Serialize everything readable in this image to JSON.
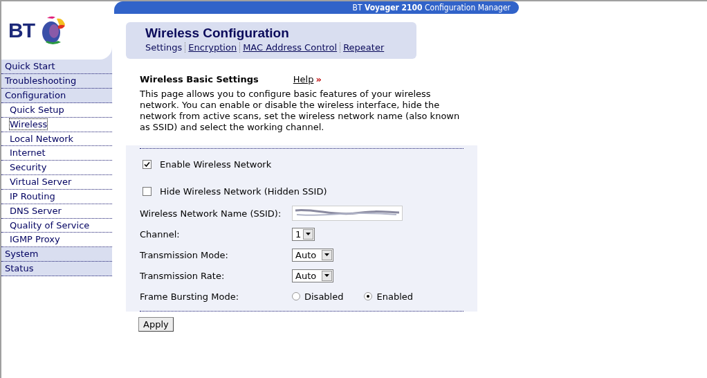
{
  "header": {
    "title": "BT **Voyager 2100** Configuration Manager"
  },
  "logo": {
    "text": "BT"
  },
  "sidebar": {
    "items": [
      {
        "label": "Quick Start",
        "selected": false
      },
      {
        "label": "Troubleshooting",
        "selected": false
      },
      {
        "label": "Configuration",
        "selected": false,
        "children": [
          {
            "label": "Quick Setup",
            "selected": false
          },
          {
            "label": "Wireless",
            "selected": true
          },
          {
            "label": "Local Network",
            "selected": false
          },
          {
            "label": "Internet",
            "selected": false
          },
          {
            "label": "Security",
            "selected": false
          },
          {
            "label": "Virtual Server",
            "selected": false
          },
          {
            "label": "IP Routing",
            "selected": false
          },
          {
            "label": "DNS Server",
            "selected": false
          },
          {
            "label": "Quality of Service",
            "selected": false
          },
          {
            "label": "IGMP Proxy",
            "selected": false
          }
        ]
      },
      {
        "label": "System",
        "selected": false
      },
      {
        "label": "Status",
        "selected": false
      }
    ]
  },
  "page": {
    "title": "Wireless Configuration",
    "tabs": [
      {
        "label": "Settings",
        "selected": true
      },
      {
        "label": "Encryption",
        "selected": false
      },
      {
        "label": "MAC Address Control",
        "selected": false
      },
      {
        "label": "Repeater",
        "selected": false
      }
    ]
  },
  "section": {
    "title": "Wireless Basic Settings",
    "help": "Help",
    "help_icon": "»",
    "description": "This page allows you to configure basic features of your wireless network. You can enable or disable the wireless interface, hide the network from active scans, set the wireless network name (also known as SSID) and select the working channel."
  },
  "form": [
    {
      "kind": "checkbox",
      "label": "Enable Wireless Network",
      "checked": true
    },
    {
      "kind": "checkbox",
      "label": "Hide Wireless Network (Hidden SSID)",
      "checked": false
    },
    {
      "kind": "text",
      "label": "Wireless Network Name (SSID):",
      "redacted": true
    },
    {
      "kind": "select",
      "label": "Channel:",
      "value": "1"
    },
    {
      "kind": "select",
      "label": "Transmission Mode:",
      "value": "Auto"
    },
    {
      "kind": "select",
      "label": "Transmission Rate:",
      "value": "Auto"
    },
    {
      "kind": "radio",
      "label": "Frame Bursting Mode:",
      "options": [
        {
          "label": "Disabled",
          "selected": false
        },
        {
          "label": "Enabled",
          "selected": true
        }
      ]
    }
  ],
  "apply_button": "Apply"
}
